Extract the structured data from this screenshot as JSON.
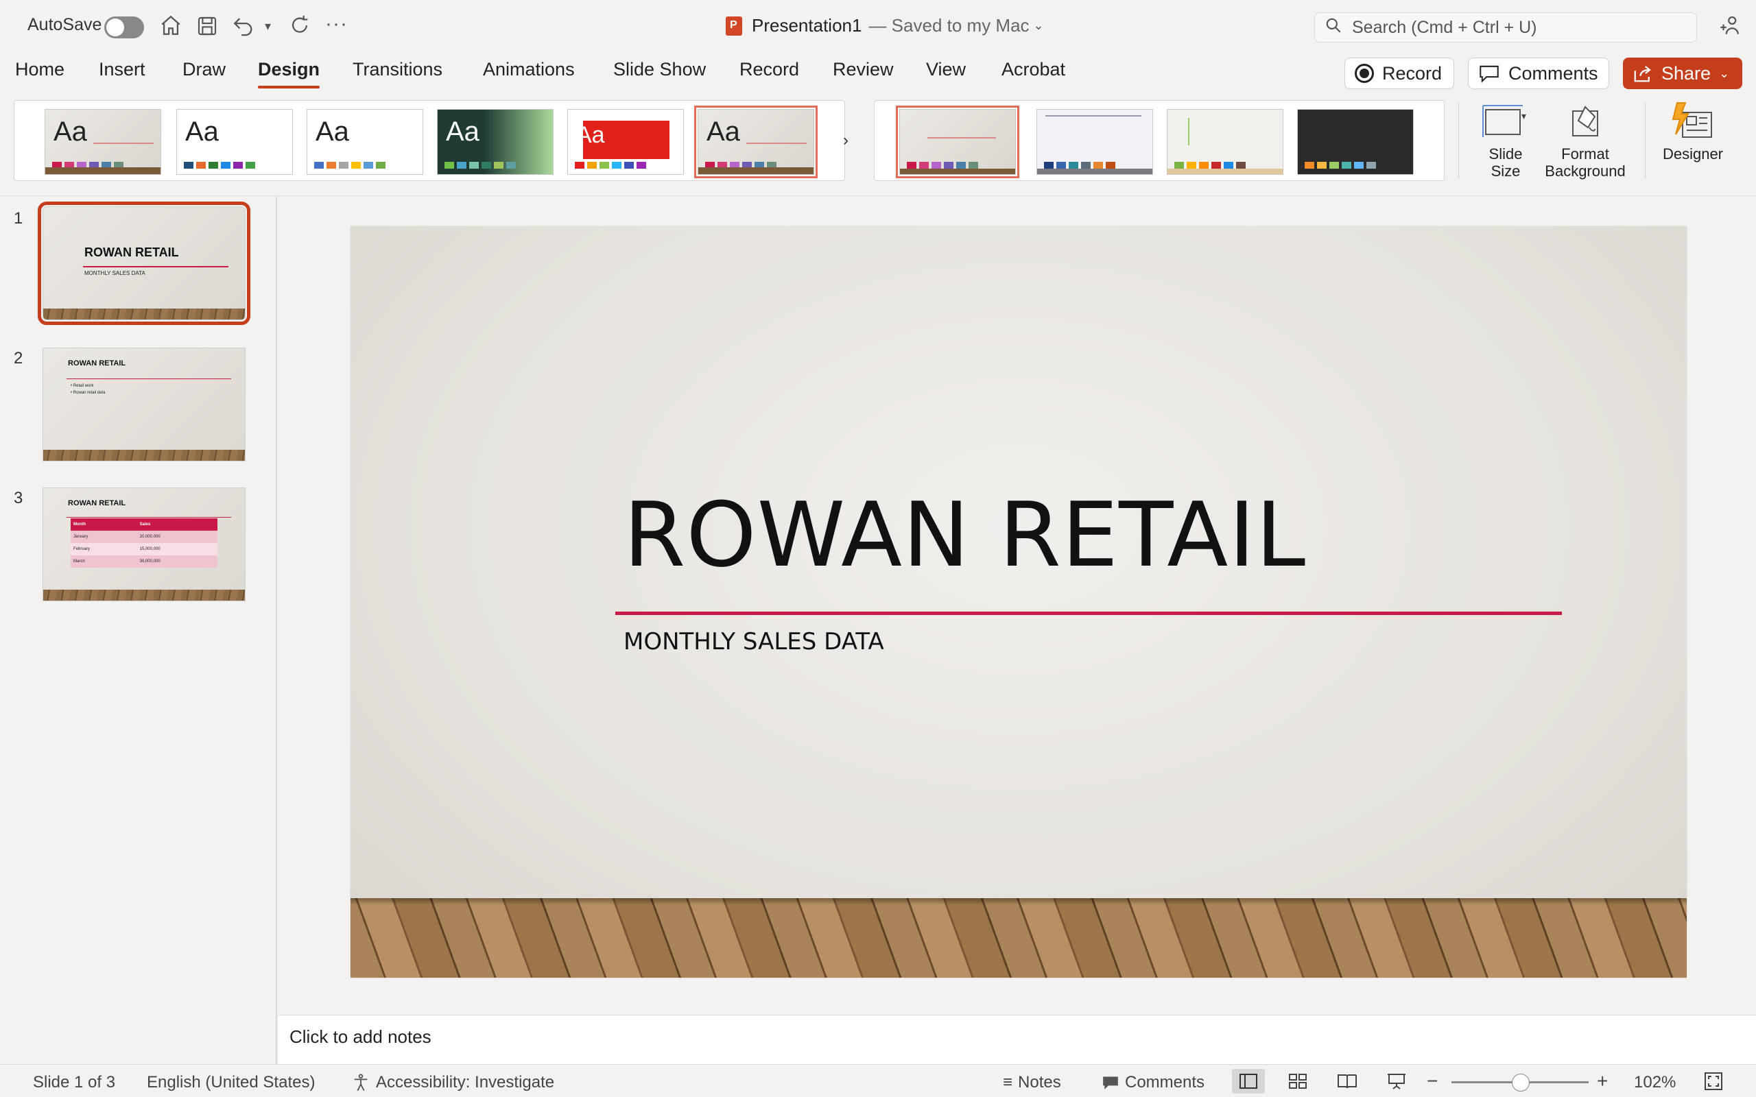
{
  "titlebar": {
    "autosave_label": "AutoSave",
    "doc_title": "Presentation1",
    "doc_status": "— Saved to my Mac",
    "search_placeholder": "Search (Cmd + Ctrl + U)"
  },
  "tabs": [
    "Home",
    "Insert",
    "Draw",
    "Design",
    "Transitions",
    "Animations",
    "Slide Show",
    "Record",
    "Review",
    "View",
    "Acrobat"
  ],
  "active_tab": "Design",
  "actions": {
    "record": "Record",
    "comments": "Comments",
    "share": "Share"
  },
  "themes": [
    {
      "label": "Aa",
      "bg": "#e6e3de",
      "text": "#111",
      "swatches": [
        "#c9184a",
        "#d13c78",
        "#b565c9",
        "#6f5bb4",
        "#4b7fa8",
        "#6b8e7a"
      ]
    },
    {
      "label": "Aa",
      "bg": "#ffffff",
      "text": "#111",
      "swatches": [
        "#1f4e79",
        "#e46b2d",
        "#2e7d32",
        "#1e88e5",
        "#8e24aa",
        "#43a047"
      ]
    },
    {
      "label": "Aa",
      "bg": "#ffffff",
      "text": "#111",
      "swatches": [
        "#4472c4",
        "#ed7d31",
        "#a5a5a5",
        "#ffc000",
        "#5b9bd5",
        "#70ad47"
      ]
    },
    {
      "label": "Aa",
      "bg": "#1f3b34",
      "text": "#ffffff",
      "swatches": [
        "#6fbf4a",
        "#4aa3c9",
        "#7cc4a8",
        "#2f7d5e",
        "#a3c45a",
        "#5f9ea0"
      ]
    },
    {
      "label": "Aa",
      "bg": "#ffffff",
      "text": "#ffffff",
      "swatches": [
        "#e0201a",
        "#f0a30a",
        "#8bc34a",
        "#29b6f6",
        "#3f51b5",
        "#9c27b0"
      ]
    },
    {
      "label": "Aa",
      "bg": "#e6e3de",
      "text": "#111",
      "swatches": [
        "#c9184a",
        "#d13c78",
        "#b565c9",
        "#6f5bb4",
        "#4b7fa8",
        "#6b8e7a"
      ]
    }
  ],
  "variants": [
    {
      "bg": "#e8e5e0",
      "swatches": [
        "#c9184a",
        "#d13c78",
        "#b565c9",
        "#6f5bb4",
        "#4b7fa8",
        "#6b8e7a"
      ]
    },
    {
      "bg": "#f2f2f6",
      "swatches": [
        "#1f3f7a",
        "#3a66b0",
        "#2a8a9a",
        "#5b6b7a",
        "#e6862f",
        "#c04f15"
      ]
    },
    {
      "bg": "#f0f0ec",
      "swatches": [
        "#7cb342",
        "#ffb300",
        "#fb8c00",
        "#c62828",
        "#1e88e5",
        "#6d4c41"
      ]
    },
    {
      "bg": "#2b2b2b",
      "swatches": [
        "#f28c28",
        "#f5b942",
        "#9ccc65",
        "#4db6ac",
        "#64b5f6",
        "#90a4ae"
      ]
    }
  ],
  "ribbon_buttons": {
    "slide_size": "Slide\nSize",
    "slide_size_l1": "Slide",
    "slide_size_l2": "Size",
    "format_bg_l1": "Format",
    "format_bg_l2": "Background",
    "designer": "Designer"
  },
  "thumbnails": [
    {
      "num": "1",
      "title": "ROWAN RETAIL",
      "subtitle": "MONTHLY SALES DATA"
    },
    {
      "num": "2",
      "title": "ROWAN RETAIL",
      "bullets": [
        "Retail work",
        "Rowan retail data"
      ]
    },
    {
      "num": "3",
      "title": "ROWAN RETAIL",
      "table_headers": [
        "Month",
        "Sales"
      ],
      "table_rows": [
        [
          "January",
          "20,000,000"
        ],
        [
          "February",
          "15,000,000"
        ],
        [
          "March",
          "30,000,000"
        ]
      ]
    }
  ],
  "slide": {
    "title": "ROWAN RETAIL",
    "subtitle": "MONTHLY SALES DATA"
  },
  "notes_placeholder": "Click to add notes",
  "status": {
    "slide_counter": "Slide 1 of 3",
    "language": "English (United States)",
    "accessibility": "Accessibility: Investigate",
    "notes": "Notes",
    "comments": "Comments",
    "zoom": "102%"
  },
  "colors": {
    "accent": "#c43e1c",
    "slide_rule": "#c9184a"
  }
}
